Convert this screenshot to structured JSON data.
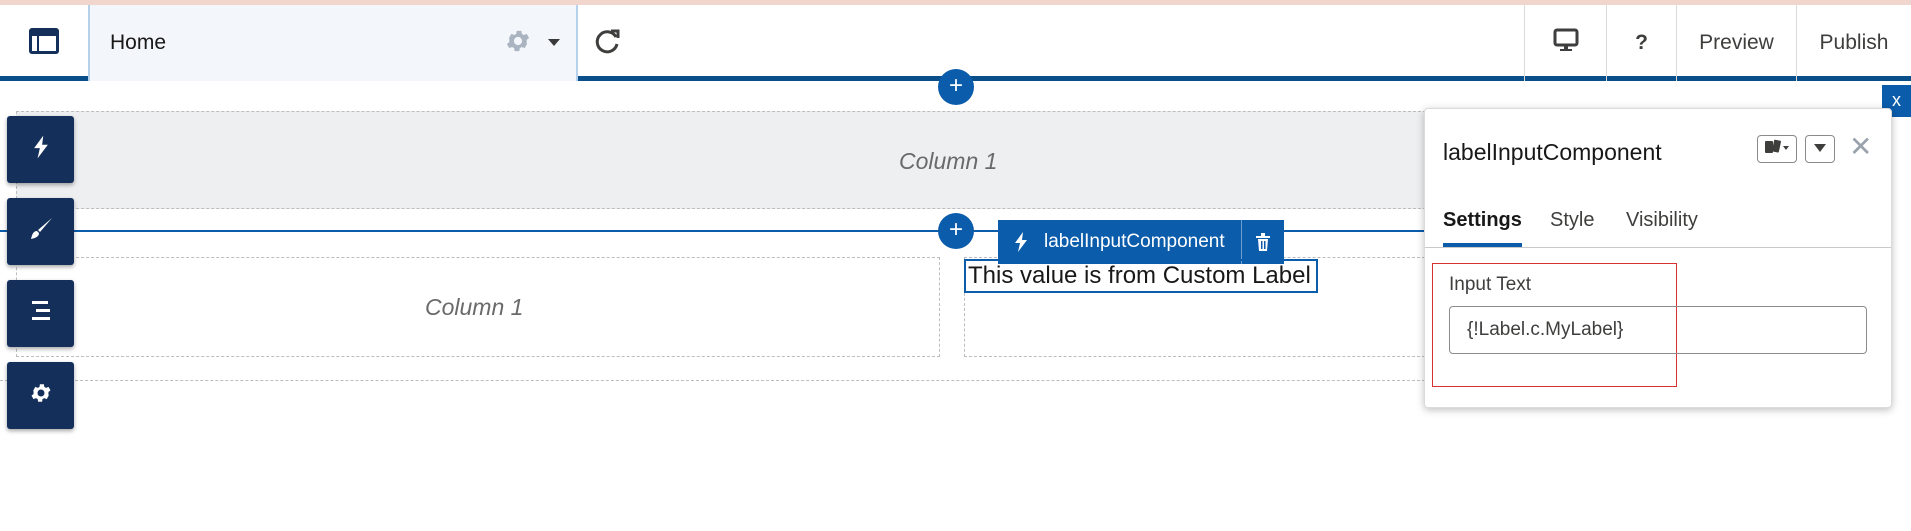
{
  "header": {
    "page_name": "Home",
    "buttons": {
      "preview": "Preview",
      "publish": "Publish",
      "help": "?"
    }
  },
  "canvas": {
    "top_region_label": "Column 1",
    "bottom_left_label": "Column 1",
    "add_symbol": "+",
    "component_tab_label": "labelInputComponent",
    "component_content": "This value is from Custom Label"
  },
  "close_canvas_label": "x",
  "panel": {
    "title": "labelInputComponent",
    "close_symbol": "✕",
    "tabs": [
      "Settings",
      "Style",
      "Visibility"
    ],
    "active_tab": "Settings",
    "field_label": "Input Text",
    "field_value": "{!Label.c.MyLabel}"
  },
  "colors": {
    "brand_blue": "#0b5cab",
    "sidebar_navy": "#14305a",
    "highlight_red": "#d93030"
  },
  "icons": {
    "app": "layout-icon",
    "settings": "gear-icon",
    "dropdown": "caret-down-icon",
    "refresh": "refresh-icon",
    "device": "desktop-icon",
    "components": "lightning-icon",
    "theme": "brush-icon",
    "structure": "list-icon",
    "site_settings": "gear-icon",
    "delete": "trash-icon"
  }
}
